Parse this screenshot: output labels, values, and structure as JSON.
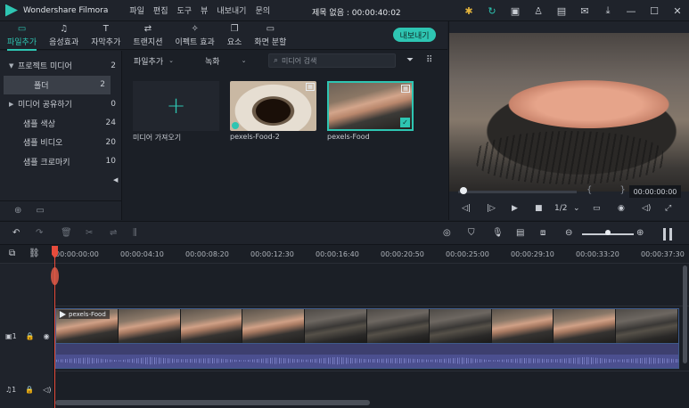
{
  "app": {
    "name": "Wondershare Filmora",
    "menu": [
      "파일",
      "편집",
      "도구",
      "뷰",
      "내보내기",
      "문의"
    ],
    "doc_title": "제목 없음 : 00:00:40:02",
    "icons": [
      "bulb-icon",
      "sync-icon",
      "gift-icon",
      "user-icon",
      "save-icon",
      "mail-icon",
      "download-icon",
      "minimize-icon",
      "maximize-icon",
      "close-icon"
    ]
  },
  "toolbar": {
    "tabs": [
      {
        "label": "파일추가",
        "icon": "folder-icon",
        "active": true
      },
      {
        "label": "음성효과",
        "icon": "music-note-icon",
        "active": false
      },
      {
        "label": "자막추가",
        "icon": "text-icon",
        "active": false
      },
      {
        "label": "트랜지션",
        "icon": "transition-icon",
        "active": false
      },
      {
        "label": "이펙트 효과",
        "icon": "effects-icon",
        "active": false
      },
      {
        "label": "요소",
        "icon": "elements-icon",
        "active": false
      },
      {
        "label": "화면 분할",
        "icon": "split-screen-icon",
        "active": false
      }
    ],
    "export_label": "내보내기",
    "accent_color": "#2ec5b2"
  },
  "sidebar": {
    "items": [
      {
        "label": "프로젝트 미디어",
        "count": "2",
        "arrow": "▼"
      },
      {
        "label": "폴더",
        "count": "2",
        "arrow": ""
      },
      {
        "label": "미디어 공유하기",
        "count": "0",
        "arrow": "▶"
      },
      {
        "label": "샘플 색상",
        "count": "24",
        "arrow": ""
      },
      {
        "label": "샘플 비디오",
        "count": "20",
        "arrow": ""
      },
      {
        "label": "샘플 크로마키",
        "count": "10",
        "arrow": ""
      }
    ]
  },
  "media": {
    "dropdown1": "파일추가",
    "dropdown2": "녹화",
    "search_placeholder": "미디어 검색",
    "tiles": [
      {
        "label": "미디어 가져오기"
      },
      {
        "label": "pexels-Food-2"
      },
      {
        "label": "pexels-Food"
      }
    ]
  },
  "preview": {
    "time": "00:00:00:00",
    "quality": "1/2"
  },
  "timeline": {
    "ruler": [
      "00:00:00:00",
      "00:00:04:10",
      "00:00:08:20",
      "00:00:12:30",
      "00:00:16:40",
      "00:00:20:50",
      "00:00:25:00",
      "00:00:29:10",
      "00:00:33:20",
      "00:00:37:30"
    ],
    "clip_label": "pexels-Food",
    "track_video_num": "1",
    "track_audio_num": "1"
  }
}
